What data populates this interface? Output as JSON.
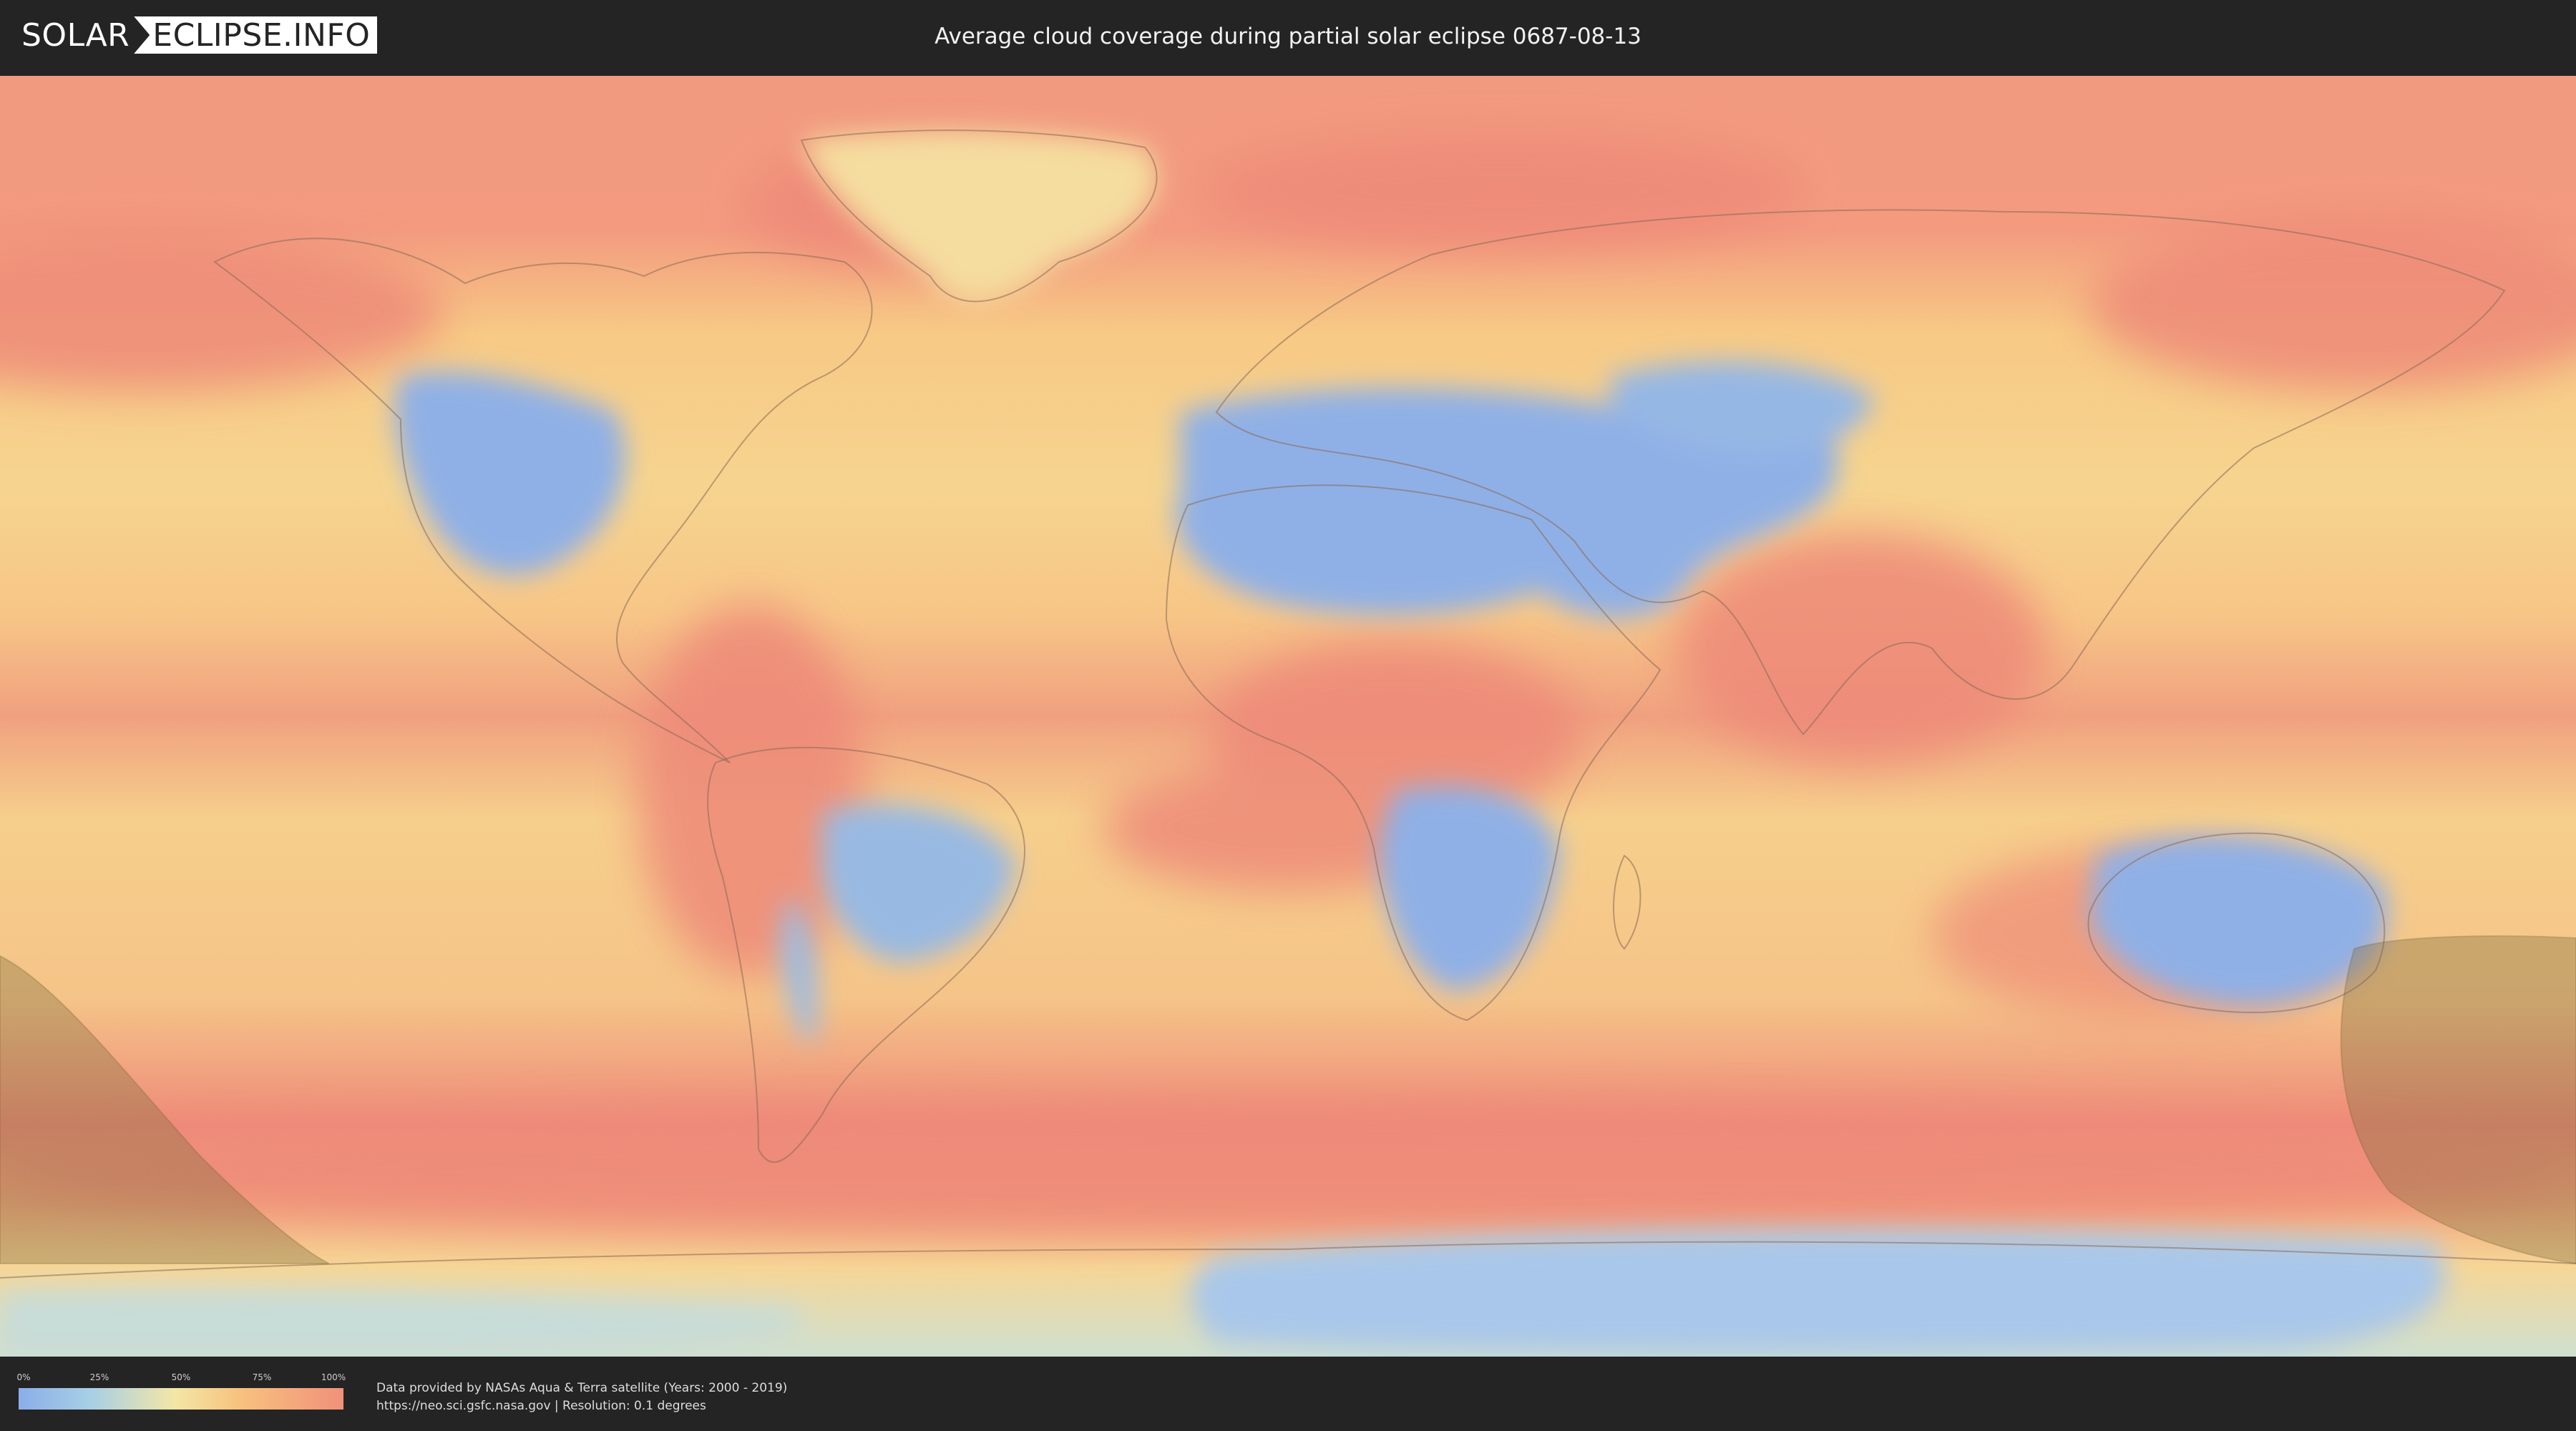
{
  "header": {
    "logo_part1": "SOLAR",
    "logo_part2": "ECLIPSE.INFO",
    "title": "Average cloud coverage during partial solar eclipse 0687-08-13"
  },
  "legend": {
    "ticks": [
      "0%",
      "25%",
      "50%",
      "75%",
      "100%"
    ],
    "colors": {
      "low": "#8aaee8",
      "mid": "#f3e6a6",
      "high": "#f1907a"
    }
  },
  "footer": {
    "credit_line1": "Data provided by NASAs Aqua & Terra satellite (Years: 2000 - 2019)",
    "credit_line2": "https://neo.sci.gsfc.nasa.gov | Resolution: 0.1 degrees"
  }
}
